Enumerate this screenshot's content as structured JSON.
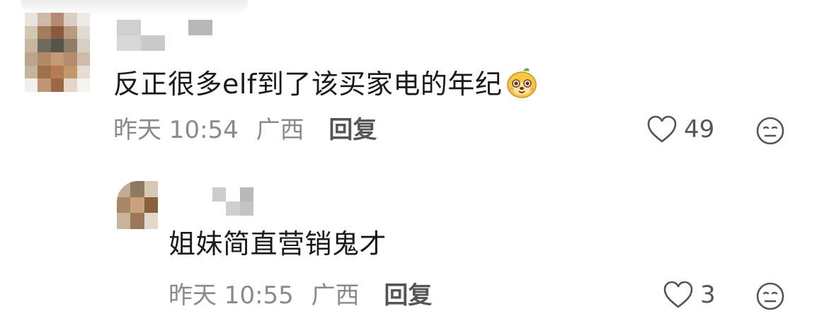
{
  "comments": [
    {
      "text": "反正很多elf到了该买家电的年纪",
      "emoji": "mango-face-emoji",
      "time": "昨天 10:54",
      "location": "广西",
      "reply_label": "回复",
      "likes": "49"
    },
    {
      "text": "姐妹简直营销鬼才",
      "time": "昨天 10:55",
      "location": "广西",
      "reply_label": "回复",
      "likes": "3"
    }
  ],
  "icons": {
    "like": "heart-outline-icon",
    "dislike": "meh-face-icon"
  },
  "colors": {
    "text": "#1a1a1a",
    "meta": "#8a8a8a",
    "icon": "#555555"
  }
}
